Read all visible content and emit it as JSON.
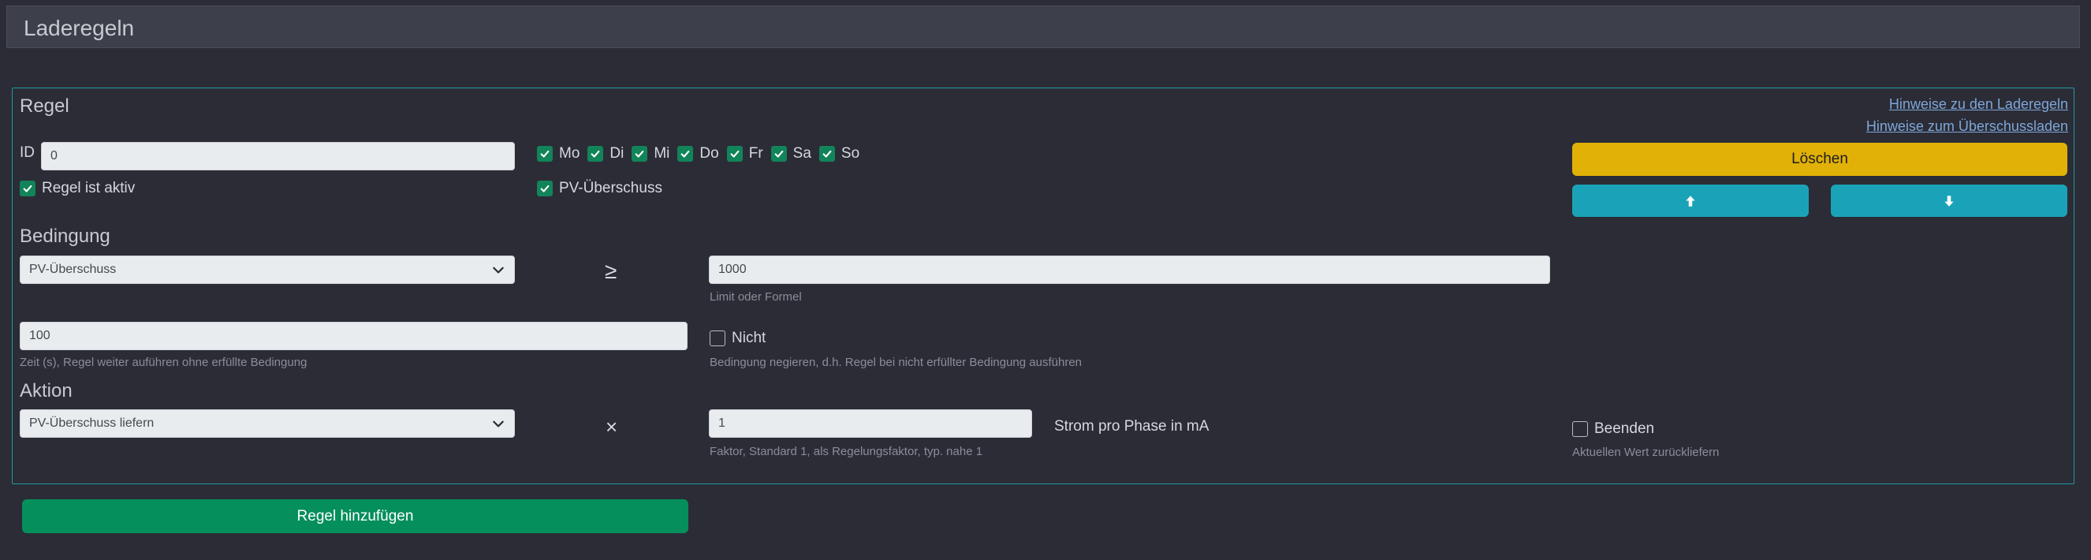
{
  "header": {
    "title": "Laderegeln"
  },
  "rule": {
    "section_title": "Regel",
    "links": [
      "Hinweise zu den Laderegeln",
      "Hinweise zum Überschussladen"
    ],
    "id_label": "ID",
    "id_value": "0",
    "active_label": "Regel ist aktiv",
    "active_checked": true,
    "days": [
      {
        "label": "Mo",
        "checked": true
      },
      {
        "label": "Di",
        "checked": true
      },
      {
        "label": "Mi",
        "checked": true
      },
      {
        "label": "Do",
        "checked": true
      },
      {
        "label": "Fr",
        "checked": true
      },
      {
        "label": "Sa",
        "checked": true
      },
      {
        "label": "So",
        "checked": true
      }
    ],
    "pv_label": "PV-Überschuss",
    "pv_checked": true,
    "delete_label": "Löschen"
  },
  "condition": {
    "section_title": "Bedingung",
    "select_value": "PV-Überschuss",
    "operator": "≥",
    "limit_value": "1000",
    "limit_hint": "Limit oder Formel",
    "time_value": "100",
    "time_hint": "Zeit (s), Regel weiter auführen ohne erfüllte Bedingung",
    "not_label": "Nicht",
    "not_checked": false,
    "not_hint": "Bedingung negieren, d.h. Regel bei nicht erfüllter Bedingung ausführen"
  },
  "action": {
    "section_title": "Aktion",
    "select_value": "PV-Überschuss liefern",
    "operator": "×",
    "factor_value": "1",
    "factor_hint": "Faktor, Standard 1, als Regelungsfaktor, typ. nahe 1",
    "unit_label": "Strom pro Phase in mA",
    "end_label": "Beenden",
    "end_checked": false,
    "end_hint": "Aktuellen Wert zurückliefern"
  },
  "footer": {
    "add_rule_label": "Regel hinzufügen"
  },
  "colors": {
    "background": "#2b2c36",
    "accent_border": "#1e9aa5",
    "yellow_button": "#e2b107",
    "cyan_button": "#1aa3b8",
    "green_button": "#058f5c",
    "checkbox": "#12845a"
  },
  "icons": {
    "up": "arrow-up-icon",
    "down": "arrow-down-icon",
    "dropdown": "chevron-down-icon",
    "check": "check-icon"
  }
}
